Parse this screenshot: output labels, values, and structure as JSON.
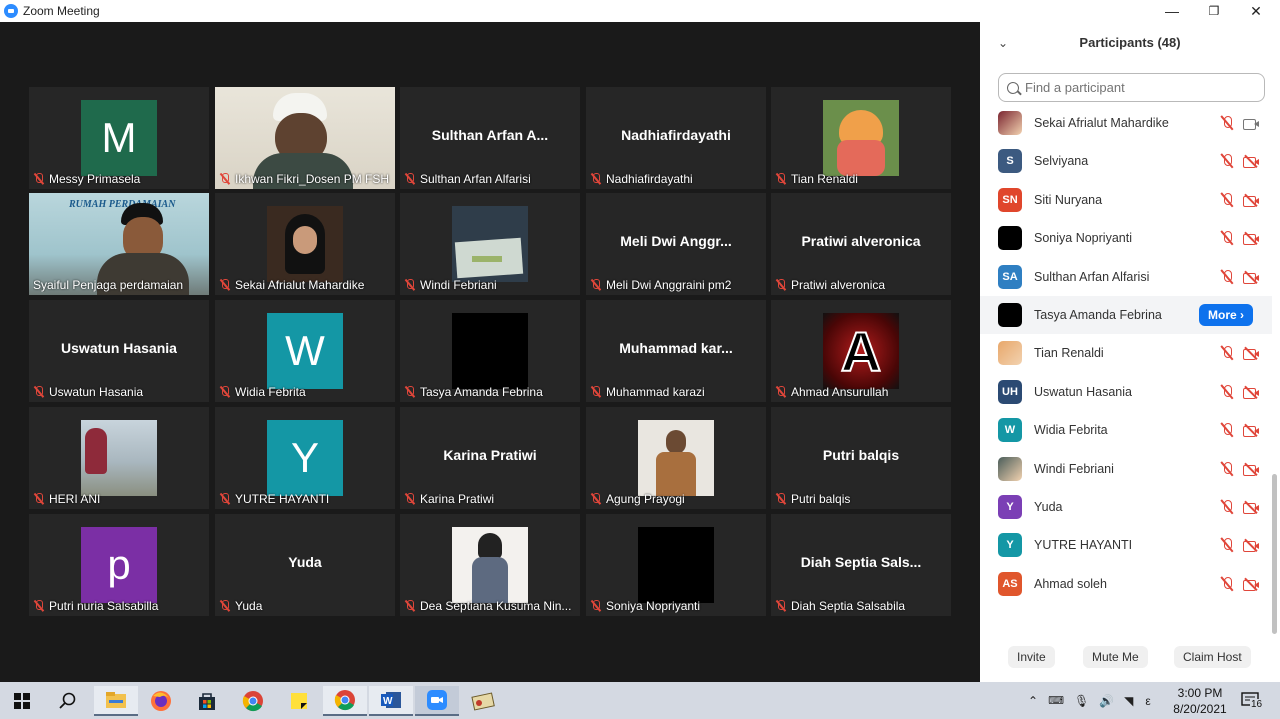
{
  "window": {
    "title": "Zoom Meeting",
    "minimize": "—",
    "restore": "❐",
    "close": "✕"
  },
  "gallery": [
    {
      "kind": "letter",
      "letter": "M",
      "bg": "#1f6a4c",
      "label": "Messy Primasela"
    },
    {
      "kind": "photo",
      "photo": "face-cap",
      "label": "Ikhwan Fikri_Dosen PM FSH UI..."
    },
    {
      "kind": "name",
      "bigname": "Sulthan Arfan A...",
      "label": "Sulthan Arfan Alfarisi"
    },
    {
      "kind": "name",
      "bigname": "Nadhiafirdayathi",
      "label": "Nadhiafirdayathi"
    },
    {
      "kind": "photo",
      "photo": "anime",
      "label": "Tian Renaldi"
    },
    {
      "kind": "video",
      "label": "Syaiful Penjaga perdamaian",
      "banner": "RUMAH PERDAMAIAN",
      "active": true
    },
    {
      "kind": "photo",
      "photo": "hijab-girl",
      "label": "Sekai Afrialut Mahardike"
    },
    {
      "kind": "photo",
      "photo": "book",
      "label": "Windi Febriani"
    },
    {
      "kind": "name",
      "bigname": "Meli Dwi Anggr...",
      "label": "Meli Dwi Anggraini pm2"
    },
    {
      "kind": "name",
      "bigname": "Pratiwi alveronica",
      "label": "Pratiwi alveronica"
    },
    {
      "kind": "name",
      "bigname": "Uswatun Hasania",
      "label": "Uswatun Hasania"
    },
    {
      "kind": "letter",
      "letter": "W",
      "bg": "#1497a5",
      "label": "Widia Febrita"
    },
    {
      "kind": "photo",
      "photo": "black",
      "label": "Tasya Amanda Febrina"
    },
    {
      "kind": "name",
      "bigname": "Muhammad kar...",
      "label": "Muhammad karazi"
    },
    {
      "kind": "photo",
      "photo": "letter-a",
      "label": "Ahmad Ansurullah"
    },
    {
      "kind": "photo",
      "photo": "beach",
      "label": "HERI ANI"
    },
    {
      "kind": "letter",
      "letter": "Y",
      "bg": "#1497a5",
      "label": "YUTRE HAYANTI"
    },
    {
      "kind": "name",
      "bigname": "Karina Pratiwi",
      "label": "Karina Pratiwi"
    },
    {
      "kind": "photo",
      "photo": "man",
      "label": "Agung Prayogi"
    },
    {
      "kind": "name",
      "bigname": "Putri balqis",
      "label": "Putri balqis"
    },
    {
      "kind": "letter",
      "letter": "p",
      "bg": "#7b2fa5",
      "label": "Putri nuria Salsabilla"
    },
    {
      "kind": "name",
      "bigname": "Yuda",
      "label": "Yuda"
    },
    {
      "kind": "photo",
      "photo": "drawing",
      "label": "Dea Septiana Kusuma Nin..."
    },
    {
      "kind": "photo",
      "photo": "black",
      "label": "Soniya Nopriyanti"
    },
    {
      "kind": "name",
      "bigname": "Diah Septia Sals...",
      "label": "Diah Septia Salsabila"
    }
  ],
  "participants": {
    "title": "Participants (48)",
    "search_placeholder": "Find a participant",
    "list": [
      {
        "name": "Sekai Afrialut Mahardike",
        "avatar": "",
        "bg": "#7a2530",
        "photo": true,
        "cam": "on"
      },
      {
        "name": "Selviyana",
        "avatar": "S",
        "bg": "#3c5a80",
        "cam": "off"
      },
      {
        "name": "Siti Nuryana",
        "avatar": "SN",
        "bg": "#e0462c",
        "cam": "off"
      },
      {
        "name": "Soniya Nopriyanti",
        "avatar": "",
        "bg": "#000000",
        "cam": "off"
      },
      {
        "name": "Sulthan Arfan Alfarisi",
        "avatar": "SA",
        "bg": "#2f7fc2",
        "cam": "off"
      },
      {
        "name": "Tasya Amanda Febrina",
        "avatar": "",
        "bg": "#000000",
        "more": "More"
      },
      {
        "name": "Tian Renaldi",
        "avatar": "",
        "bg": "#e8a76a",
        "photo": true,
        "cam": "off"
      },
      {
        "name": "Uswatun Hasania",
        "avatar": "UH",
        "bg": "#2b4a73",
        "cam": "off"
      },
      {
        "name": "Widia Febrita",
        "avatar": "W",
        "bg": "#1497a5",
        "cam": "off"
      },
      {
        "name": "Windi Febriani",
        "avatar": "",
        "bg": "#4a5d5a",
        "photo": true,
        "cam": "off"
      },
      {
        "name": "Yuda",
        "avatar": "Y",
        "bg": "#7b3fb5",
        "cam": "off"
      },
      {
        "name": "YUTRE HAYANTI",
        "avatar": "Y",
        "bg": "#1497a5",
        "cam": "off"
      },
      {
        "name": "Ahmad soleh",
        "avatar": "AS",
        "bg": "#e0562c",
        "cam": "off"
      }
    ],
    "footer": {
      "invite": "Invite",
      "mute_me": "Mute Me",
      "claim_host": "Claim Host"
    }
  },
  "taskbar": {
    "time": "3:00 PM",
    "date": "8/20/2021",
    "notifications": "16",
    "lang": "ε"
  }
}
